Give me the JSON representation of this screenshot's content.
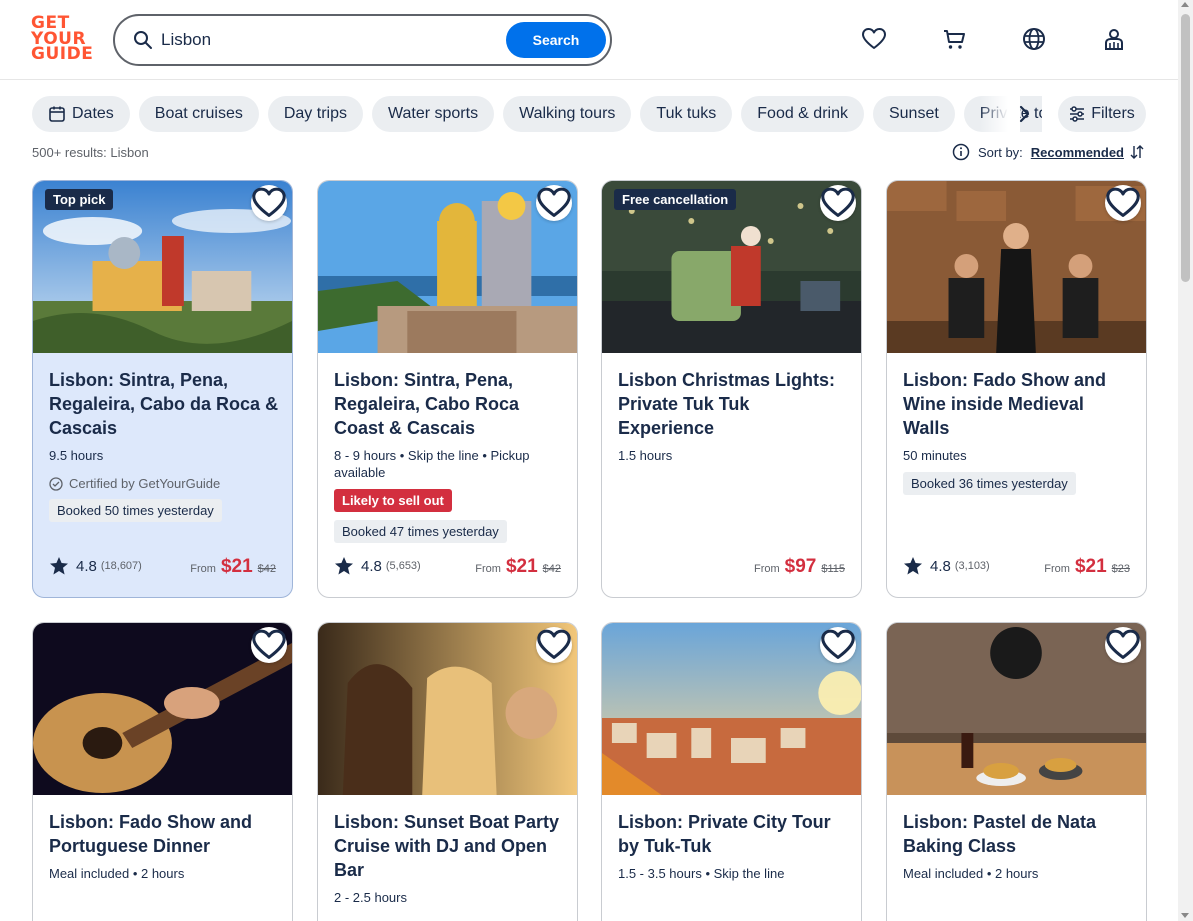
{
  "brand": {
    "line1": "GET",
    "line2": "YOUR",
    "line3": "GUIDE",
    "color": "#ff5533"
  },
  "search": {
    "value": "Lisbon",
    "button_label": "Search"
  },
  "header_icons": [
    "wishlist-heart-icon",
    "cart-icon",
    "language-globe-icon",
    "account-icon"
  ],
  "chips": [
    {
      "label": "Dates",
      "icon": "calendar-icon"
    },
    {
      "label": "Boat cruises"
    },
    {
      "label": "Day trips"
    },
    {
      "label": "Water sports"
    },
    {
      "label": "Walking tours"
    },
    {
      "label": "Tuk tuks"
    },
    {
      "label": "Food & drink"
    },
    {
      "label": "Sunset"
    },
    {
      "label": "Private tours"
    }
  ],
  "filters_label": "Filters",
  "results_text": "500+ results: Lisbon",
  "sort": {
    "label": "Sort by:",
    "value": "Recommended"
  },
  "colors": {
    "accent": "#0071eb",
    "price": "#d32f3f",
    "badge": "#1a2b49",
    "highlight": "#dde8fb"
  },
  "cards": [
    {
      "badge": "Top pick",
      "title": "Lisbon: Sintra, Pena, Regaleira, Cabo da Roca & Cascais",
      "meta": "9.5 hours",
      "certified": "Certified by GetYourGuide",
      "tag": "",
      "booked": "Booked 50 times yesterday",
      "rating": "4.8",
      "reviews": "(18,607)",
      "from": "From",
      "price": "$21",
      "old_price": "$42"
    },
    {
      "badge": "",
      "title": "Lisbon: Sintra, Pena, Regaleira, Cabo Roca Coast & Cascais",
      "meta": "8 - 9 hours • Skip the line • Pickup available",
      "certified": "",
      "tag": "Likely to sell out",
      "booked": "Booked 47 times yesterday",
      "rating": "4.8",
      "reviews": "(5,653)",
      "from": "From",
      "price": "$21",
      "old_price": "$42"
    },
    {
      "badge": "Free cancellation",
      "title": "Lisbon Christmas Lights: Private Tuk Tuk Experience",
      "meta": "1.5 hours",
      "certified": "",
      "tag": "",
      "booked": "",
      "rating": "",
      "reviews": "",
      "from": "From",
      "price": "$97",
      "old_price": "$115"
    },
    {
      "badge": "",
      "title": "Lisbon: Fado Show and Wine inside Medieval Walls",
      "meta": "50 minutes",
      "certified": "",
      "tag": "",
      "booked": "Booked 36 times yesterday",
      "rating": "4.8",
      "reviews": "(3,103)",
      "from": "From",
      "price": "$21",
      "old_price": "$23"
    },
    {
      "badge": "",
      "title": "Lisbon: Fado Show and Portuguese Dinner",
      "meta": "Meal included • 2 hours"
    },
    {
      "badge": "",
      "title": "Lisbon: Sunset Boat Party Cruise with DJ and Open Bar",
      "meta": "2 - 2.5 hours"
    },
    {
      "badge": "",
      "title": "Lisbon: Private City Tour by Tuk-Tuk",
      "meta": "1.5 - 3.5 hours • Skip the line"
    },
    {
      "badge": "",
      "title": "Lisbon: Pastel de Nata Baking Class",
      "meta": "Meal included • 2 hours"
    }
  ]
}
